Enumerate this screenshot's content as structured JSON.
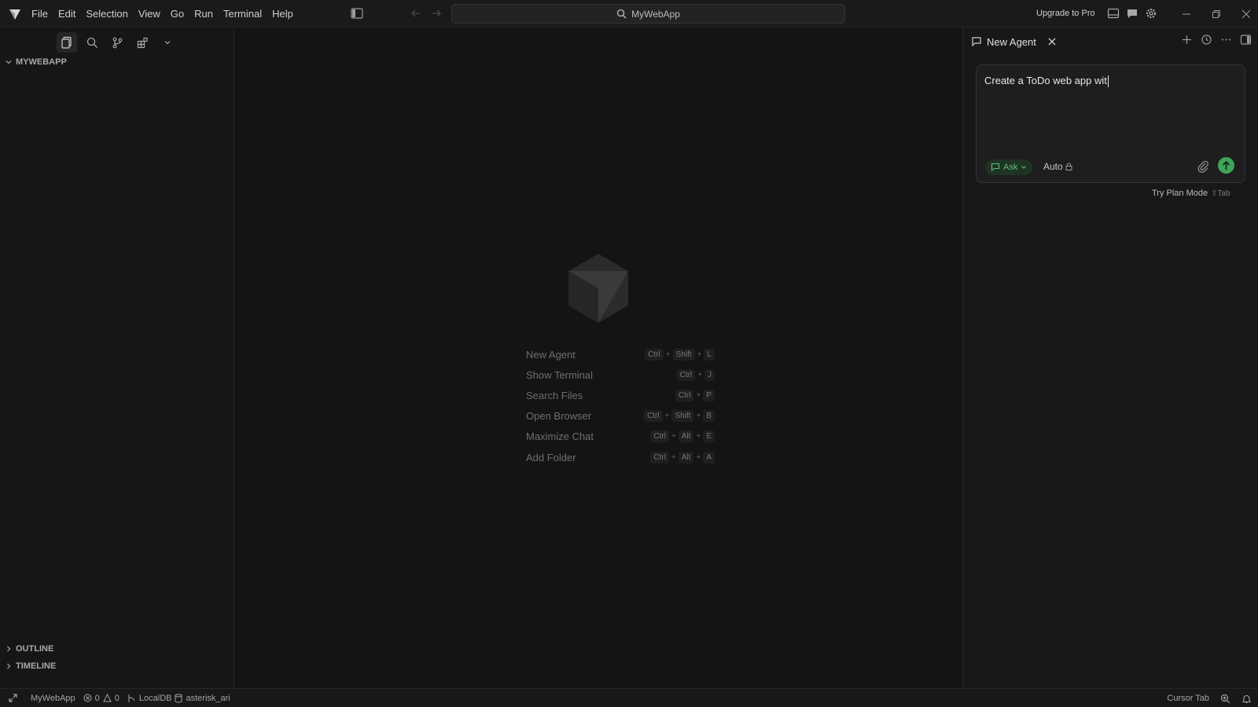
{
  "titlebar": {
    "menu": [
      "File",
      "Edit",
      "Selection",
      "View",
      "Go",
      "Run",
      "Terminal",
      "Help"
    ],
    "search_label": "MyWebApp",
    "upgrade_label": "Upgrade to Pro"
  },
  "sidebar": {
    "project_title": "MYWEBAPP",
    "outline_label": "OUTLINE",
    "timeline_label": "TIMELINE"
  },
  "editor": {
    "shortcuts": [
      {
        "label": "New Agent",
        "keys": [
          "Ctrl",
          "+",
          "Shift",
          "+",
          "L"
        ]
      },
      {
        "label": "Show Terminal",
        "keys": [
          "Ctrl",
          "+",
          "J"
        ]
      },
      {
        "label": "Search Files",
        "keys": [
          "Ctrl",
          "+",
          "P"
        ]
      },
      {
        "label": "Open Browser",
        "keys": [
          "Ctrl",
          "+",
          "Shift",
          "+",
          "B"
        ]
      },
      {
        "label": "Maximize Chat",
        "keys": [
          "Ctrl",
          "+",
          "Alt",
          "+",
          "E"
        ]
      },
      {
        "label": "Add Folder",
        "keys": [
          "Ctrl",
          "+",
          "Alt",
          "+",
          "A"
        ]
      }
    ]
  },
  "agent": {
    "tab_label": "New Agent",
    "input_text": "Create a ToDo web app wit",
    "mode_label": "Ask",
    "model_label": "Auto",
    "plan_hint": "Try Plan Mode",
    "plan_hint_key": "⇧Tab",
    "accent_color": "#3fa45a"
  },
  "statusbar": {
    "project": "MyWebApp",
    "errors": "0",
    "warnings": "0",
    "db_label": "LocalDB",
    "user_label": "asterisk_ari",
    "cursor_tab": "Cursor Tab"
  }
}
